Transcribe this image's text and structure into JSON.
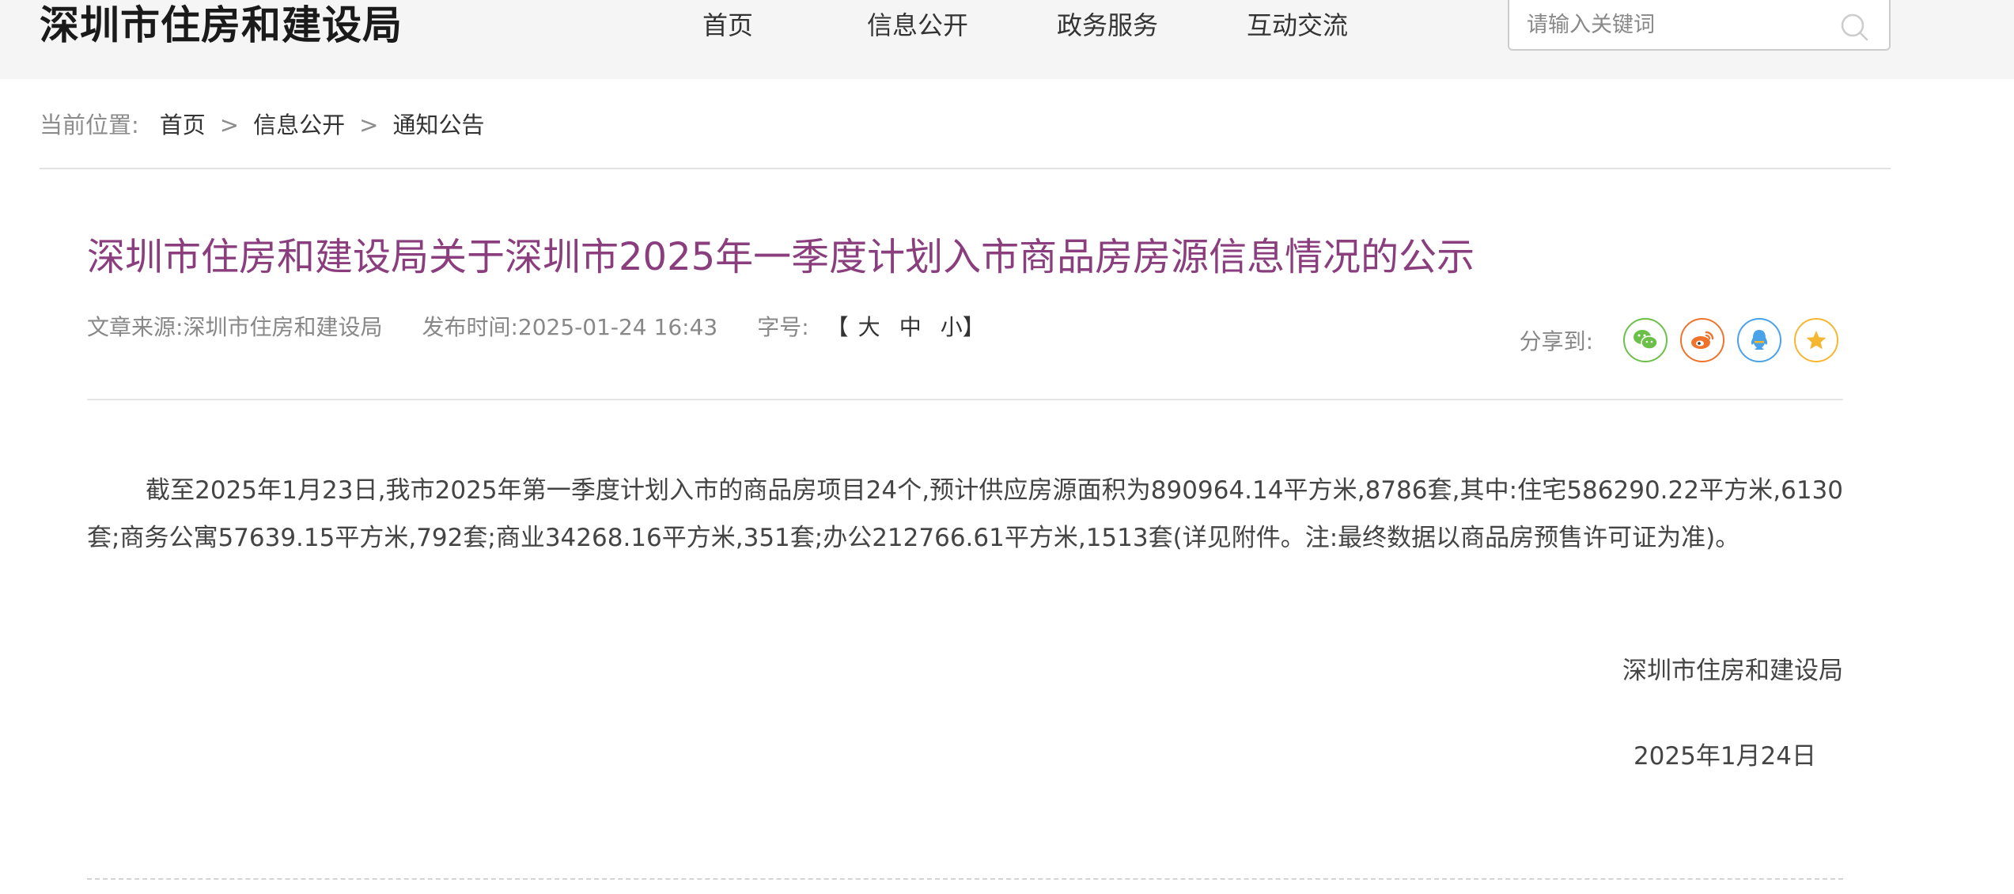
{
  "header": {
    "site_title": "深圳市住房和建设局",
    "nav": [
      {
        "label": "首页"
      },
      {
        "label": "信息公开"
      },
      {
        "label": "政务服务"
      },
      {
        "label": "互动交流"
      }
    ],
    "search": {
      "placeholder": "请输入关键词",
      "icon": "search-icon"
    }
  },
  "breadcrumb": {
    "prefix": "当前位置:",
    "items": [
      {
        "label": "首页"
      },
      {
        "label": "信息公开"
      },
      {
        "label": "通知公告"
      }
    ],
    "separator": ">"
  },
  "article": {
    "title": "深圳市住房和建设局关于深圳市2025年一季度计划入市商品房房源信息情况的公示",
    "title_color": "#8a3e7e",
    "meta": {
      "source_label": "文章来源:",
      "source_value": "深圳市住房和建设局",
      "date_label": "发布时间:",
      "date_value": "2025-01-24 16:43",
      "font_label": "字号:",
      "bracket_open": "【",
      "bracket_close": "】",
      "font_large": "大",
      "font_medium": "中",
      "font_small": "小"
    },
    "share": {
      "label": "分享到:",
      "buttons": [
        {
          "name": "wechat-icon",
          "color": "#6cc04a"
        },
        {
          "name": "weibo-icon",
          "color": "#f0732c"
        },
        {
          "name": "qq-icon",
          "color": "#4aa3e8"
        },
        {
          "name": "favorite-star-icon",
          "color": "#f5b731"
        }
      ]
    },
    "body": "截至2025年1月23日,我市2025年第一季度计划入市的商品房项目24个,预计供应房源面积为890964.14平方米,8786套,其中:住宅586290.22平方米,6130套;商务公寓57639.15平方米,792套;商业34268.16平方米,351套;办公212766.61平方米,1513套(详见附件。注:最终数据以商品房预售许可证为准)。",
    "signature": "深圳市住房和建设局",
    "sign_date": "2025年1月24日"
  }
}
